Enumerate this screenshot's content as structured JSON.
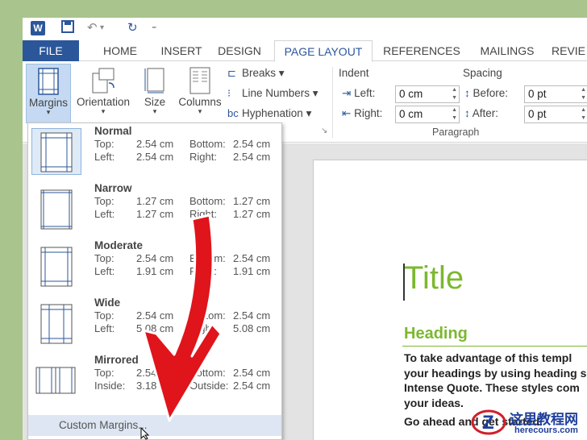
{
  "qat": {
    "undo": "↶",
    "undo_caret": "▾",
    "redo": "↻",
    "custom": "₌"
  },
  "tabs": [
    "FILE",
    "HOME",
    "INSERT",
    "DESIGN",
    "PAGE LAYOUT",
    "REFERENCES",
    "MAILINGS",
    "REVIE"
  ],
  "ribbon": {
    "margins": "Margins",
    "orientation": "Orientation",
    "size": "Size",
    "columns": "Columns",
    "breaks": "Breaks",
    "line_numbers": "Line Numbers",
    "hyphenation": "Hyphenation",
    "indent_label": "Indent",
    "indent_left_label": "Left:",
    "indent_left_value": "0 cm",
    "indent_right_label": "Right:",
    "indent_right_value": "0 cm",
    "spacing_label": "Spacing",
    "before_label": "Before:",
    "before_value": "0 pt",
    "after_label": "After:",
    "after_value": "0 pt",
    "paragraph_group": "Paragraph",
    "dialog_launcher": "↘"
  },
  "margins_menu": {
    "options": [
      {
        "name": "Normal",
        "k1": "Top:",
        "v1": "2.54 cm",
        "k2": "Bottom:",
        "v2": "2.54 cm",
        "k3": "Left:",
        "v3": "2.54 cm",
        "k4": "Right:",
        "v4": "2.54 cm",
        "selected": true
      },
      {
        "name": "Narrow",
        "k1": "Top:",
        "v1": "1.27 cm",
        "k2": "Bottom:",
        "v2": "1.27 cm",
        "k3": "Left:",
        "v3": "1.27 cm",
        "k4": "Right:",
        "v4": "1.27 cm",
        "selected": false
      },
      {
        "name": "Moderate",
        "k1": "Top:",
        "v1": "2.54 cm",
        "k2": "Bottom:",
        "v2": "2.54 cm",
        "k3": "Left:",
        "v3": "1.91 cm",
        "k4": "Right:",
        "v4": "1.91 cm",
        "selected": false
      },
      {
        "name": "Wide",
        "k1": "Top:",
        "v1": "2.54 cm",
        "k2": "Bottom:",
        "v2": "2.54 cm",
        "k3": "Left:",
        "v3": "5.08 cm",
        "k4": "Right:",
        "v4": "5.08 cm",
        "selected": false
      },
      {
        "name": "Mirrored",
        "k1": "Top:",
        "v1": "2.54 cm",
        "k2": "Bottom:",
        "v2": "2.54 cm",
        "k3": "Inside:",
        "v3": "3.18 cm",
        "k4": "Outside:",
        "v4": "2.54 cm",
        "selected": false
      }
    ],
    "custom": "Custom Margins..."
  },
  "document": {
    "title": "Title",
    "heading": "Heading",
    "body_lines": [
      "To take advantage of this templ",
      "your headings by using heading s",
      "Intense Quote. These styles com",
      "your ideas."
    ],
    "body2": "Go ahead and get started."
  },
  "watermark": {
    "brand": "这里教程网",
    "url": "herecours.com"
  },
  "colors": {
    "accent": "#2b579a",
    "title_green": "#7cb82f",
    "arrow_red": "#e0141b",
    "background": "#a9c48c"
  }
}
